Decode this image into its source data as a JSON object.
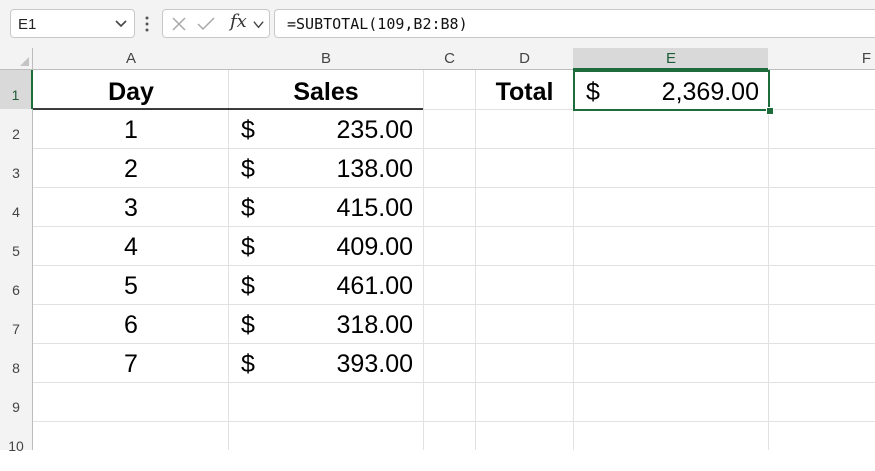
{
  "formula_bar": {
    "name_box": "E1",
    "formula": "=SUBTOTAL(109,B2:B8)",
    "fx_label": "fx"
  },
  "sheet": {
    "columns": [
      "A",
      "B",
      "C",
      "D",
      "E",
      "F"
    ],
    "rows": [
      "1",
      "2",
      "3",
      "4",
      "5",
      "6",
      "7",
      "8",
      "9",
      "10"
    ],
    "selected_cell": "E1",
    "header": {
      "day": "Day",
      "sales": "Sales"
    },
    "data": [
      {
        "day": "1",
        "currency": "$",
        "amount": "235.00"
      },
      {
        "day": "2",
        "currency": "$",
        "amount": "138.00"
      },
      {
        "day": "3",
        "currency": "$",
        "amount": "415.00"
      },
      {
        "day": "4",
        "currency": "$",
        "amount": "409.00"
      },
      {
        "day": "5",
        "currency": "$",
        "amount": "461.00"
      },
      {
        "day": "6",
        "currency": "$",
        "amount": "318.00"
      },
      {
        "day": "7",
        "currency": "$",
        "amount": "393.00"
      }
    ],
    "total": {
      "label": "Total",
      "currency": "$",
      "amount": "2,369.00"
    }
  },
  "colors": {
    "accent": "#1e6b3c",
    "gridline": "#e1e1e1",
    "header_bg": "#f3f3f3"
  }
}
